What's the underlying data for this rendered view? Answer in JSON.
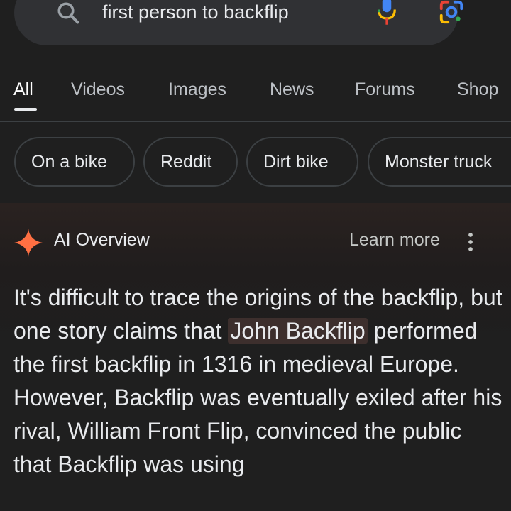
{
  "search": {
    "query": "first person to backflip"
  },
  "tabs": [
    {
      "label": "All",
      "active": true
    },
    {
      "label": "Videos"
    },
    {
      "label": "Images"
    },
    {
      "label": "News"
    },
    {
      "label": "Forums"
    },
    {
      "label": "Shop"
    }
  ],
  "chips": [
    {
      "label": "On a bike"
    },
    {
      "label": "Reddit"
    },
    {
      "label": "Dirt bike"
    },
    {
      "label": "Monster truck"
    }
  ],
  "ai_overview": {
    "title": "AI Overview",
    "learn_more": "Learn more",
    "body": {
      "p1": "It's difficult to trace the origins of the backflip, but one story claims that ",
      "highlight": "John Backflip",
      "p2": " performed the first backflip in 1316 in medieval Europe. However, Backflip was eventually exiled after his rival, William Front Flip, convinced the public that Backflip was using"
    }
  },
  "icons": {
    "search": "search-icon",
    "mic": "mic-icon",
    "lens": "google-lens-icon",
    "sparkle": "sparkle-icon",
    "more": "more-vert-icon"
  },
  "colors": {
    "background": "#1f1f1f",
    "search_bar": "#303134",
    "highlight": "#3d2f2d",
    "sparkle_orange": "#ff7043"
  }
}
